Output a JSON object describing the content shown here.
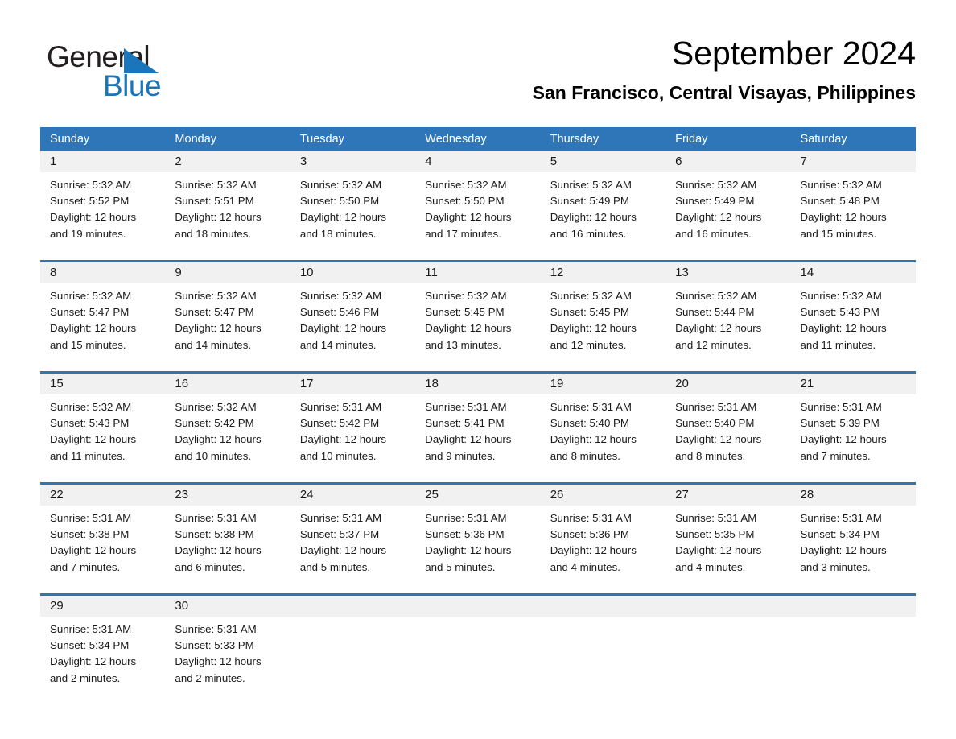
{
  "brand": {
    "word_one": "General",
    "word_two": "Blue",
    "accent_color": "#1b75bb"
  },
  "header": {
    "title": "September 2024",
    "location": "San Francisco, Central Visayas, Philippines",
    "header_bg_color": "#2f76b8",
    "daynum_band_color": "#f1f1f1"
  },
  "weekdays": [
    "Sunday",
    "Monday",
    "Tuesday",
    "Wednesday",
    "Thursday",
    "Friday",
    "Saturday"
  ],
  "labels": {
    "sunrise_prefix": "Sunrise:",
    "sunset_prefix": "Sunset:",
    "daylight_prefix": "Daylight:"
  },
  "weeks": [
    [
      {
        "day": "1",
        "sunrise": "Sunrise: 5:32 AM",
        "sunset": "Sunset: 5:52 PM",
        "daylight_line1": "Daylight: 12 hours",
        "daylight_line2": "and 19 minutes."
      },
      {
        "day": "2",
        "sunrise": "Sunrise: 5:32 AM",
        "sunset": "Sunset: 5:51 PM",
        "daylight_line1": "Daylight: 12 hours",
        "daylight_line2": "and 18 minutes."
      },
      {
        "day": "3",
        "sunrise": "Sunrise: 5:32 AM",
        "sunset": "Sunset: 5:50 PM",
        "daylight_line1": "Daylight: 12 hours",
        "daylight_line2": "and 18 minutes."
      },
      {
        "day": "4",
        "sunrise": "Sunrise: 5:32 AM",
        "sunset": "Sunset: 5:50 PM",
        "daylight_line1": "Daylight: 12 hours",
        "daylight_line2": "and 17 minutes."
      },
      {
        "day": "5",
        "sunrise": "Sunrise: 5:32 AM",
        "sunset": "Sunset: 5:49 PM",
        "daylight_line1": "Daylight: 12 hours",
        "daylight_line2": "and 16 minutes."
      },
      {
        "day": "6",
        "sunrise": "Sunrise: 5:32 AM",
        "sunset": "Sunset: 5:49 PM",
        "daylight_line1": "Daylight: 12 hours",
        "daylight_line2": "and 16 minutes."
      },
      {
        "day": "7",
        "sunrise": "Sunrise: 5:32 AM",
        "sunset": "Sunset: 5:48 PM",
        "daylight_line1": "Daylight: 12 hours",
        "daylight_line2": "and 15 minutes."
      }
    ],
    [
      {
        "day": "8",
        "sunrise": "Sunrise: 5:32 AM",
        "sunset": "Sunset: 5:47 PM",
        "daylight_line1": "Daylight: 12 hours",
        "daylight_line2": "and 15 minutes."
      },
      {
        "day": "9",
        "sunrise": "Sunrise: 5:32 AM",
        "sunset": "Sunset: 5:47 PM",
        "daylight_line1": "Daylight: 12 hours",
        "daylight_line2": "and 14 minutes."
      },
      {
        "day": "10",
        "sunrise": "Sunrise: 5:32 AM",
        "sunset": "Sunset: 5:46 PM",
        "daylight_line1": "Daylight: 12 hours",
        "daylight_line2": "and 14 minutes."
      },
      {
        "day": "11",
        "sunrise": "Sunrise: 5:32 AM",
        "sunset": "Sunset: 5:45 PM",
        "daylight_line1": "Daylight: 12 hours",
        "daylight_line2": "and 13 minutes."
      },
      {
        "day": "12",
        "sunrise": "Sunrise: 5:32 AM",
        "sunset": "Sunset: 5:45 PM",
        "daylight_line1": "Daylight: 12 hours",
        "daylight_line2": "and 12 minutes."
      },
      {
        "day": "13",
        "sunrise": "Sunrise: 5:32 AM",
        "sunset": "Sunset: 5:44 PM",
        "daylight_line1": "Daylight: 12 hours",
        "daylight_line2": "and 12 minutes."
      },
      {
        "day": "14",
        "sunrise": "Sunrise: 5:32 AM",
        "sunset": "Sunset: 5:43 PM",
        "daylight_line1": "Daylight: 12 hours",
        "daylight_line2": "and 11 minutes."
      }
    ],
    [
      {
        "day": "15",
        "sunrise": "Sunrise: 5:32 AM",
        "sunset": "Sunset: 5:43 PM",
        "daylight_line1": "Daylight: 12 hours",
        "daylight_line2": "and 11 minutes."
      },
      {
        "day": "16",
        "sunrise": "Sunrise: 5:32 AM",
        "sunset": "Sunset: 5:42 PM",
        "daylight_line1": "Daylight: 12 hours",
        "daylight_line2": "and 10 minutes."
      },
      {
        "day": "17",
        "sunrise": "Sunrise: 5:31 AM",
        "sunset": "Sunset: 5:42 PM",
        "daylight_line1": "Daylight: 12 hours",
        "daylight_line2": "and 10 minutes."
      },
      {
        "day": "18",
        "sunrise": "Sunrise: 5:31 AM",
        "sunset": "Sunset: 5:41 PM",
        "daylight_line1": "Daylight: 12 hours",
        "daylight_line2": "and 9 minutes."
      },
      {
        "day": "19",
        "sunrise": "Sunrise: 5:31 AM",
        "sunset": "Sunset: 5:40 PM",
        "daylight_line1": "Daylight: 12 hours",
        "daylight_line2": "and 8 minutes."
      },
      {
        "day": "20",
        "sunrise": "Sunrise: 5:31 AM",
        "sunset": "Sunset: 5:40 PM",
        "daylight_line1": "Daylight: 12 hours",
        "daylight_line2": "and 8 minutes."
      },
      {
        "day": "21",
        "sunrise": "Sunrise: 5:31 AM",
        "sunset": "Sunset: 5:39 PM",
        "daylight_line1": "Daylight: 12 hours",
        "daylight_line2": "and 7 minutes."
      }
    ],
    [
      {
        "day": "22",
        "sunrise": "Sunrise: 5:31 AM",
        "sunset": "Sunset: 5:38 PM",
        "daylight_line1": "Daylight: 12 hours",
        "daylight_line2": "and 7 minutes."
      },
      {
        "day": "23",
        "sunrise": "Sunrise: 5:31 AM",
        "sunset": "Sunset: 5:38 PM",
        "daylight_line1": "Daylight: 12 hours",
        "daylight_line2": "and 6 minutes."
      },
      {
        "day": "24",
        "sunrise": "Sunrise: 5:31 AM",
        "sunset": "Sunset: 5:37 PM",
        "daylight_line1": "Daylight: 12 hours",
        "daylight_line2": "and 5 minutes."
      },
      {
        "day": "25",
        "sunrise": "Sunrise: 5:31 AM",
        "sunset": "Sunset: 5:36 PM",
        "daylight_line1": "Daylight: 12 hours",
        "daylight_line2": "and 5 minutes."
      },
      {
        "day": "26",
        "sunrise": "Sunrise: 5:31 AM",
        "sunset": "Sunset: 5:36 PM",
        "daylight_line1": "Daylight: 12 hours",
        "daylight_line2": "and 4 minutes."
      },
      {
        "day": "27",
        "sunrise": "Sunrise: 5:31 AM",
        "sunset": "Sunset: 5:35 PM",
        "daylight_line1": "Daylight: 12 hours",
        "daylight_line2": "and 4 minutes."
      },
      {
        "day": "28",
        "sunrise": "Sunrise: 5:31 AM",
        "sunset": "Sunset: 5:34 PM",
        "daylight_line1": "Daylight: 12 hours",
        "daylight_line2": "and 3 minutes."
      }
    ],
    [
      {
        "day": "29",
        "sunrise": "Sunrise: 5:31 AM",
        "sunset": "Sunset: 5:34 PM",
        "daylight_line1": "Daylight: 12 hours",
        "daylight_line2": "and 2 minutes."
      },
      {
        "day": "30",
        "sunrise": "Sunrise: 5:31 AM",
        "sunset": "Sunset: 5:33 PM",
        "daylight_line1": "Daylight: 12 hours",
        "daylight_line2": "and 2 minutes."
      },
      {
        "day": "",
        "sunrise": "",
        "sunset": "",
        "daylight_line1": "",
        "daylight_line2": ""
      },
      {
        "day": "",
        "sunrise": "",
        "sunset": "",
        "daylight_line1": "",
        "daylight_line2": ""
      },
      {
        "day": "",
        "sunrise": "",
        "sunset": "",
        "daylight_line1": "",
        "daylight_line2": ""
      },
      {
        "day": "",
        "sunrise": "",
        "sunset": "",
        "daylight_line1": "",
        "daylight_line2": ""
      },
      {
        "day": "",
        "sunrise": "",
        "sunset": "",
        "daylight_line1": "",
        "daylight_line2": ""
      }
    ]
  ]
}
